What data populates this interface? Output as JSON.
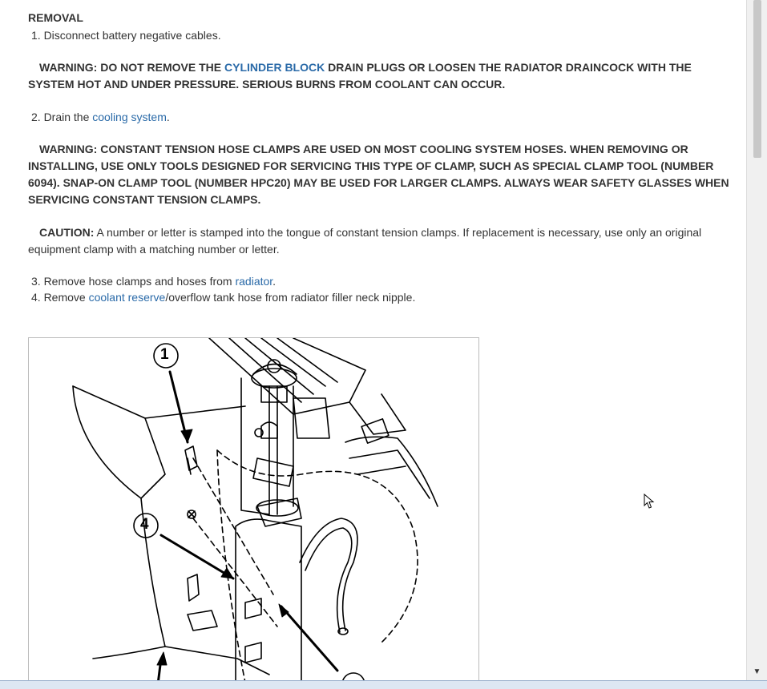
{
  "doc": {
    "heading": "REMOVAL",
    "step1": "1. Disconnect battery negative cables.",
    "warning1": {
      "prefix": "WARNING: DO NOT REMOVE THE ",
      "link": "CYLINDER BLOCK",
      "suffix": " DRAIN PLUGS OR LOOSEN THE RADIATOR DRAINCOCK WITH THE SYSTEM HOT AND UNDER PRESSURE. SERIOUS BURNS FROM COOLANT CAN OCCUR."
    },
    "step2": {
      "prefix": "2. Drain the ",
      "link": "cooling system",
      "suffix": "."
    },
    "warning2": "WARNING: CONSTANT TENSION HOSE CLAMPS ARE USED ON MOST COOLING SYSTEM HOSES. WHEN REMOVING OR INSTALLING, USE ONLY TOOLS DESIGNED FOR SERVICING THIS TYPE OF CLAMP, SUCH AS SPECIAL CLAMP TOOL (NUMBER 6094). SNAP-ON CLAMP TOOL (NUMBER HPC20) MAY BE USED FOR LARGER CLAMPS. ALWAYS WEAR SAFETY GLASSES WHEN SERVICING CONSTANT TENSION CLAMPS.",
    "caution": {
      "label": "CAUTION:",
      "text": " A number or letter is stamped into the tongue of constant tension clamps. If replacement is necessary, use only an original equipment clamp with a matching number or letter."
    },
    "step3": {
      "prefix": "3. Remove hose clamps and hoses from ",
      "link": "radiator",
      "suffix": "."
    },
    "step4": {
      "prefix": "4. Remove ",
      "link": "coolant reserve",
      "suffix": "/overflow tank hose from radiator filler neck nipple."
    }
  },
  "figure": {
    "callouts": [
      "1",
      "4"
    ]
  },
  "colors": {
    "link": "#2a6aa8",
    "text": "#333333"
  }
}
